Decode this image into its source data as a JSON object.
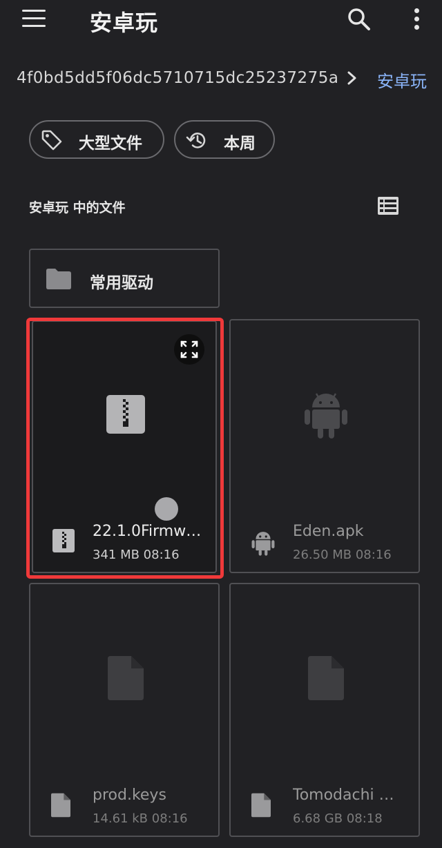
{
  "appbar": {
    "title": "安卓玩",
    "menu_icon": "menu-icon",
    "search_icon": "search-icon",
    "more_icon": "more-vert-icon"
  },
  "breadcrumb": {
    "path": "4f0bd5dd5f06dc5710715dc25237275a",
    "current": "安卓玩",
    "separator_icon": "chevron-right-icon"
  },
  "filters": [
    {
      "label": "大型文件",
      "icon": "tag-icon"
    },
    {
      "label": "本周",
      "icon": "history-icon"
    }
  ],
  "section": {
    "title": "安卓玩 中的文件",
    "view_toggle_icon": "list-view-icon"
  },
  "folders": [
    {
      "name": "常用驱动",
      "icon": "folder-icon"
    }
  ],
  "files": [
    {
      "name": "22.1.0Firmw…",
      "size": "341 MB",
      "time": "08:16",
      "meta": "341 MB 08:16",
      "type": "zip",
      "highlighted": true
    },
    {
      "name": "Eden.apk",
      "size": "26.50 MB",
      "time": "08:16",
      "meta": "26.50 MB 08:16",
      "type": "apk",
      "highlighted": false
    },
    {
      "name": "prod.keys",
      "size": "14.61 kB",
      "time": "08:16",
      "meta": "14.61 kB 08:16",
      "type": "document",
      "highlighted": false
    },
    {
      "name": "Tomodachi …",
      "size": "6.68 GB",
      "time": "08:18",
      "meta": "6.68 GB 08:18",
      "type": "document",
      "highlighted": false
    }
  ],
  "colors": {
    "background": "#212124",
    "accent_link": "#8ab4f8",
    "highlight_border": "#f0393a",
    "card_border": "#505054"
  }
}
